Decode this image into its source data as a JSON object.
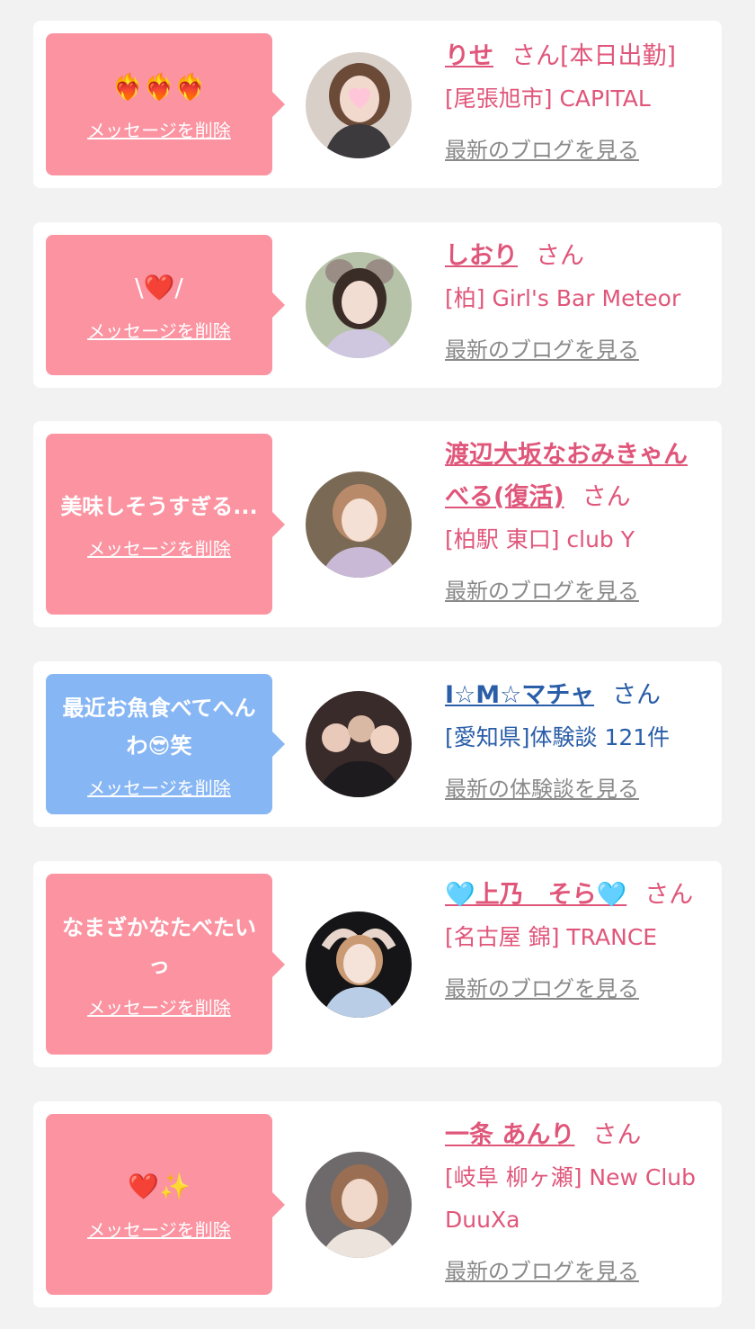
{
  "colors": {
    "pink_bubble": "#fb93a1",
    "blue_bubble": "#87b6f4",
    "pink_text": "#e0567a",
    "blue_text": "#2a5ea8",
    "gray_link": "#8a8a8a"
  },
  "cards": [
    {
      "message": "❤️‍🔥❤️‍🔥❤️‍🔥",
      "delete_label": "メッセージを削除",
      "name": "りせ",
      "honorific": "さん[本日出勤]",
      "shop": "[尾張旭市] CAPITAL",
      "blog_link": "最新のブログを見る"
    },
    {
      "message": "\\❤️/",
      "delete_label": "メッセージを削除",
      "name": "しおり",
      "honorific": "さん",
      "shop": "[柏] Girl's Bar Meteor",
      "blog_link": "最新のブログを見る"
    },
    {
      "message": "美味しそうすぎる...",
      "delete_label": "メッセージを削除",
      "name": "渡辺大坂なおみきゃんべる(復活)",
      "honorific": "さん",
      "shop": "[柏駅 東口] club Y",
      "blog_link": "最新のブログを見る"
    },
    {
      "message": "最近お魚食べてへんわ😎笑",
      "delete_label": "メッセージを削除",
      "name": "I☆M☆マチャ",
      "honorific": "さん",
      "shop": "[愛知県]体験談 121件",
      "blog_link": "最新の体験談を見る"
    },
    {
      "message": "なまざかなたべたいっ",
      "delete_label": "メッセージを削除",
      "name": "🩵上乃　そら🩵",
      "honorific": "さん",
      "shop": "[名古屋 錦] TRANCE",
      "blog_link": "最新のブログを見る"
    },
    {
      "message": "❤️✨",
      "delete_label": "メッセージを削除",
      "name": "一条 あんり",
      "honorific": "さん",
      "shop": "[岐阜 柳ヶ瀬] New Club DuuXa",
      "blog_link": "最新のブログを見る"
    }
  ]
}
